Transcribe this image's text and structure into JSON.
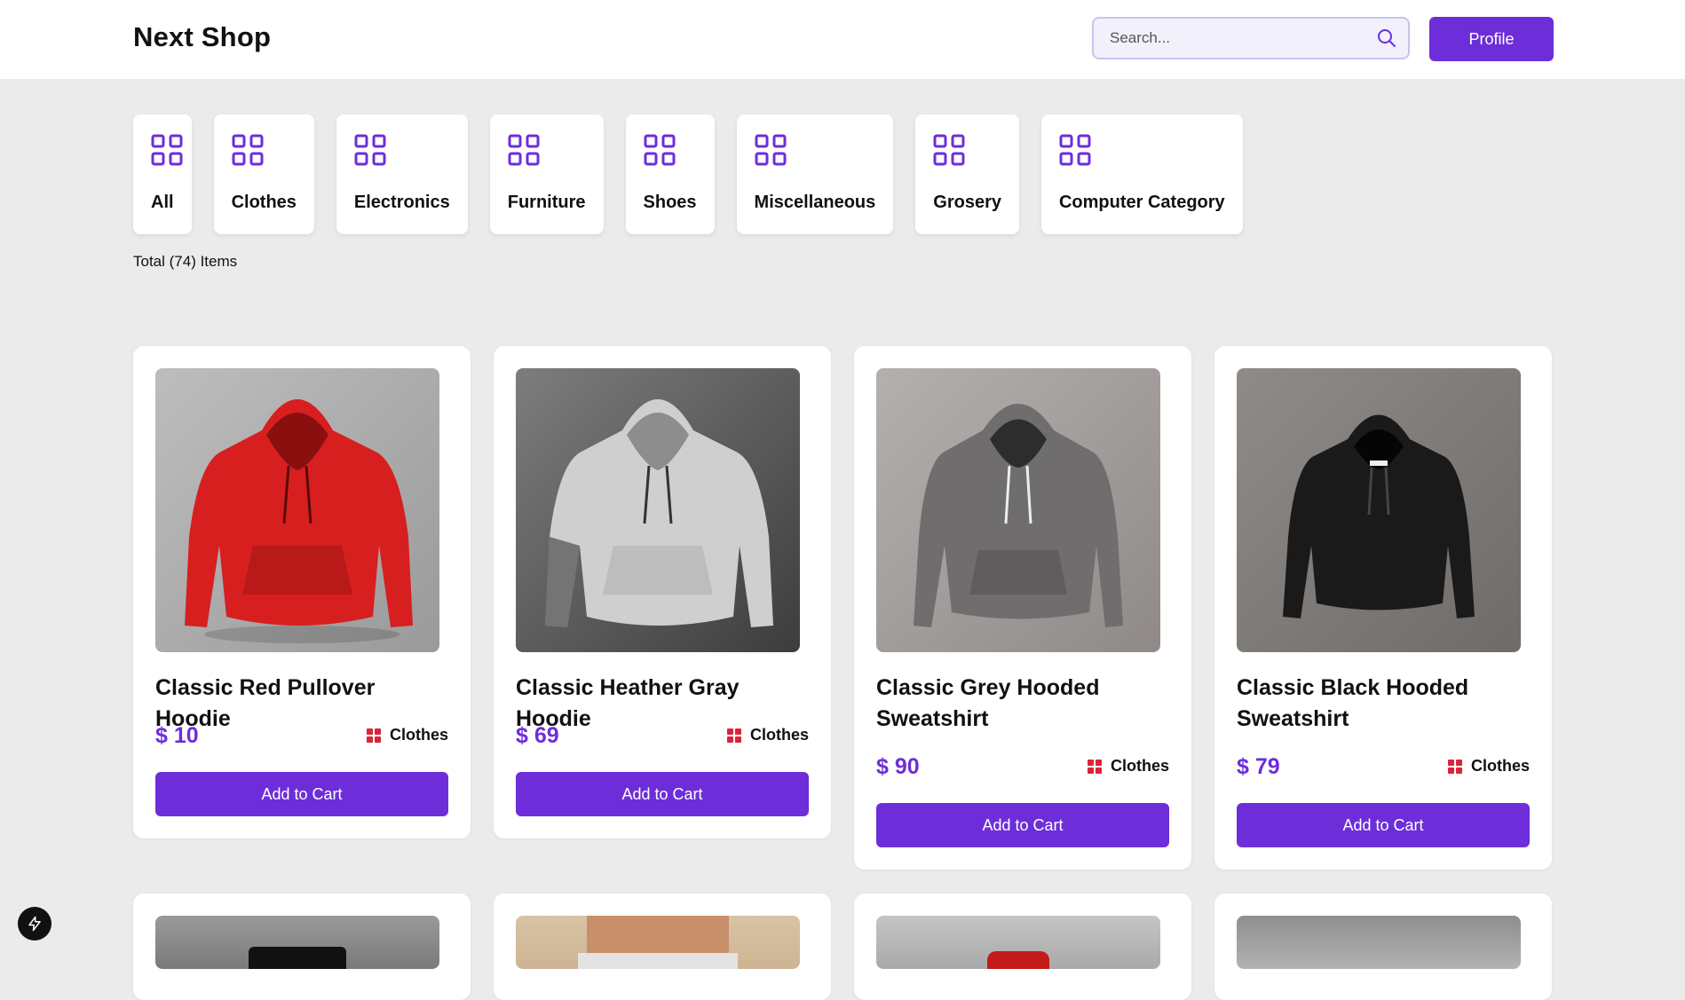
{
  "header": {
    "logo": "Next Shop",
    "search_placeholder": "Search...",
    "profile_label": "Profile"
  },
  "categories": [
    {
      "label": "All"
    },
    {
      "label": "Clothes"
    },
    {
      "label": "Electronics"
    },
    {
      "label": "Furniture"
    },
    {
      "label": "Shoes"
    },
    {
      "label": "Miscellaneous"
    },
    {
      "label": "Grosery"
    },
    {
      "label": "Computer Category"
    }
  ],
  "total_text": "Total (74) Items",
  "products": [
    {
      "title": "Classic Red Pullover Hoodie",
      "price": "$ 10",
      "category": "Clothes",
      "cta": "Add to Cart",
      "color": "#d81f1f"
    },
    {
      "title": "Classic Heather Gray Hoodie",
      "price": "$ 69",
      "category": "Clothes",
      "cta": "Add to Cart",
      "color": "#cfcfcf"
    },
    {
      "title": "Classic Grey Hooded Sweatshirt",
      "price": "$ 90",
      "category": "Clothes",
      "cta": "Add to Cart",
      "color": "#6f6d6e"
    },
    {
      "title": "Classic Black Hooded Sweatshirt",
      "price": "$ 79",
      "category": "Clothes",
      "cta": "Add to Cart",
      "color": "#1a1a1a"
    }
  ],
  "colors": {
    "accent": "#6d2ed9",
    "category_icon": "#6d2ed9",
    "tag_icon": "#d8253a",
    "background": "#ebebeb"
  }
}
